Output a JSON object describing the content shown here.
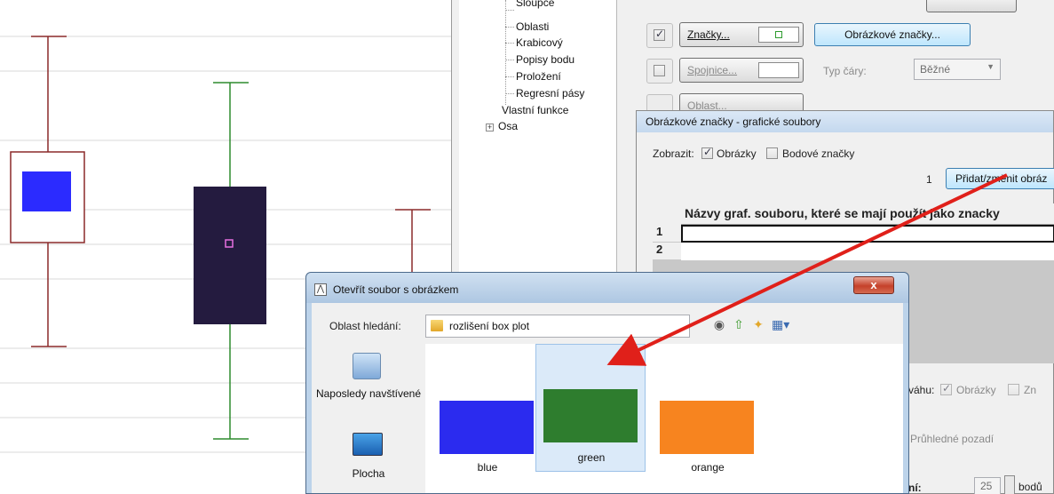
{
  "plot": {
    "colors": {
      "whisker_left": "#8b2a2a",
      "whisker_mid": "#2e8b2e",
      "box_left_border": "#8b2a2a",
      "box_left_marker": "#2b2bff",
      "box_mid_fill": "#241b3f",
      "box_mid_marker": "#e66fe0",
      "gridline": "#d9d9d9"
    }
  },
  "settings_tree": {
    "items": [
      "Sloupce",
      "Oblasti",
      "Krabicový",
      "Popisy bodu",
      "Proložení",
      "Regresní pásy",
      "Vlastní funkce",
      "Osa"
    ],
    "expander": "+"
  },
  "settings_options": {
    "marks_label": "Značky...",
    "marks_checked": true,
    "picture_marks_button": "Obrázkové značky...",
    "lines_label": "Spojnice...",
    "lines_checked": false,
    "line_type_label": "Typ čáry:",
    "line_type_value": "Běžné",
    "area_label": "Oblast..."
  },
  "graphic_files_dialog": {
    "title": "Obrázkové značky - grafické soubory",
    "show_label": "Zobrazit:",
    "pictures_label": "Obrázky",
    "pictures_checked": true,
    "point_marks_label": "Bodové značky",
    "point_marks_checked": false,
    "counter": "1",
    "add_change_button": "Přidat/změnit obráz",
    "grid_header": "Názvy graf. souboru, které se mají použít jako znacky",
    "grid_rows": [
      "1",
      "2"
    ],
    "weight_label": "váhu:",
    "weight_pictures": "Obrázky",
    "weight_other": "Zn",
    "transparent_bg": "Průhledné pozadí",
    "size_label": "ní:",
    "size_value": "25",
    "size_unit": "bodů"
  },
  "open_dialog": {
    "title": "Otevřít soubor s obrázkem",
    "close_symbol": "x",
    "look_in_label": "Oblast hledání:",
    "look_in_value": "rozlišení box plot",
    "places": [
      {
        "label": "Naposledy navštívené",
        "icon": "recent-places-icon"
      },
      {
        "label": "Plocha",
        "icon": "desktop-icon"
      }
    ],
    "files": [
      {
        "name": "blue",
        "color": "#2b2bef",
        "selected": false
      },
      {
        "name": "green",
        "color": "#2e7d2e",
        "selected": true
      },
      {
        "name": "orange",
        "color": "#f7841f",
        "selected": false
      }
    ],
    "toolbar_icons": [
      "back-icon",
      "up-folder-icon",
      "new-folder-icon",
      "view-menu-icon"
    ]
  },
  "annotation": {
    "arrow_color": "#e0201a"
  }
}
